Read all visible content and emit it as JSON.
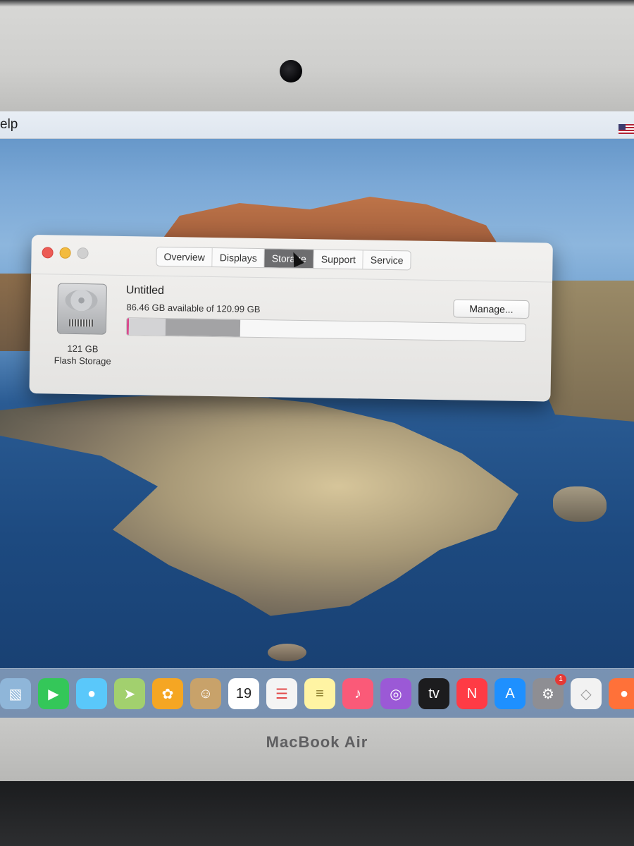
{
  "menubar": {
    "help_partial": "elp"
  },
  "window": {
    "tabs": [
      {
        "label": "Overview",
        "active": false
      },
      {
        "label": "Displays",
        "active": false
      },
      {
        "label": "Storage",
        "active": true
      },
      {
        "label": "Support",
        "active": false
      },
      {
        "label": "Service",
        "active": false
      }
    ],
    "disk": {
      "name": "Untitled",
      "available": "86.46 GB available of 120.99 GB",
      "capacity_label": "121 GB",
      "type_label": "Flash Storage",
      "used_fraction": 0.285
    },
    "manage_label": "Manage..."
  },
  "dock": {
    "items": [
      {
        "name": "preview-icon",
        "color": "#8fb6d9",
        "glyph": "▧"
      },
      {
        "name": "facetime-icon",
        "color": "#34c759",
        "glyph": "▶"
      },
      {
        "name": "messages-icon",
        "color": "#5ac8fa",
        "glyph": "●"
      },
      {
        "name": "maps-icon",
        "color": "#a2d06e",
        "glyph": "➤"
      },
      {
        "name": "photos-icon",
        "color": "#f5a623",
        "glyph": "✿"
      },
      {
        "name": "contacts-icon",
        "color": "#c8a26a",
        "glyph": "☺"
      },
      {
        "name": "calendar-icon",
        "color": "#ffffff",
        "glyph": "19",
        "text_color": "#222"
      },
      {
        "name": "reminders-icon",
        "color": "#f4f4f4",
        "glyph": "☰",
        "text_color": "#e24b4b"
      },
      {
        "name": "notes-icon",
        "color": "#fff4a3",
        "glyph": "≡",
        "text_color": "#8a7a2a"
      },
      {
        "name": "music-icon",
        "color": "#fa5a78",
        "glyph": "♪"
      },
      {
        "name": "podcasts-icon",
        "color": "#9b59d6",
        "glyph": "◎"
      },
      {
        "name": "apple-tv-icon",
        "color": "#1c1c1e",
        "glyph": "tv"
      },
      {
        "name": "news-icon",
        "color": "#ff3b45",
        "glyph": "N"
      },
      {
        "name": "app-store-icon",
        "color": "#1e90ff",
        "glyph": "A"
      },
      {
        "name": "system-preferences-icon",
        "color": "#8e8e93",
        "glyph": "⚙",
        "badge": "1"
      },
      {
        "name": "generic-app-icon",
        "color": "#f2f2f2",
        "glyph": "◇",
        "text_color": "#999"
      },
      {
        "name": "firefox-icon",
        "color": "#ff7139",
        "glyph": "●"
      }
    ]
  },
  "bezel": {
    "brand": "MacBook Air"
  }
}
